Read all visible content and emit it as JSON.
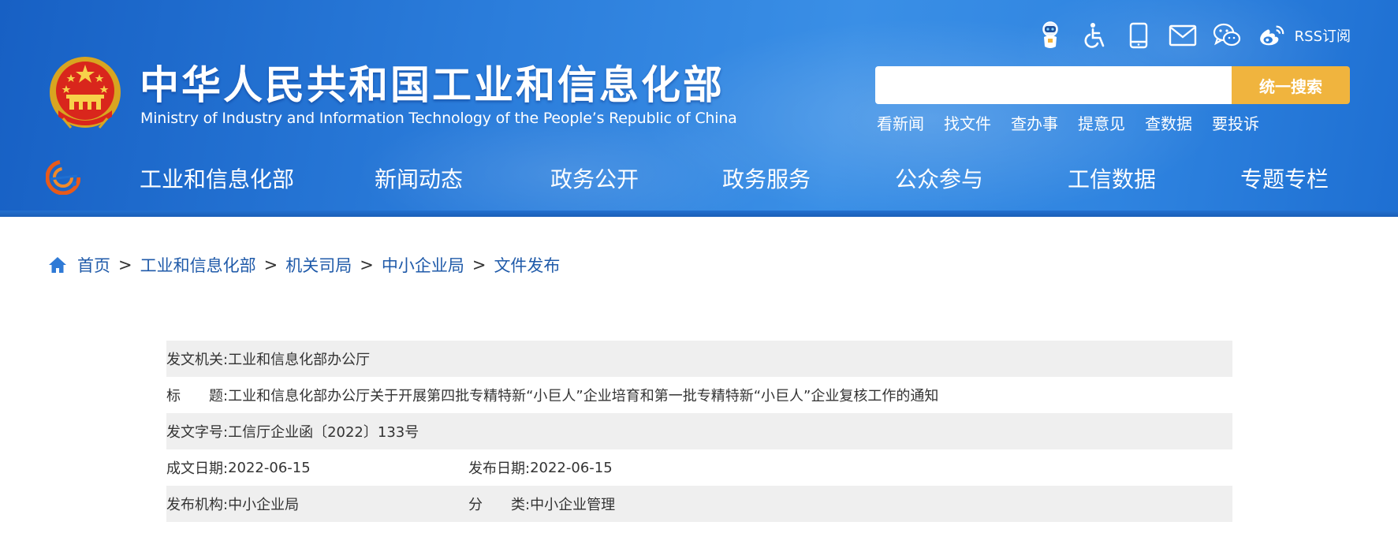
{
  "header": {
    "title_cn": "中华人民共和国工业和信息化部",
    "title_en": "Ministry of Industry and Information Technology of the People’s Republic of China",
    "tools": [
      "robot-assistant-icon",
      "accessibility-icon",
      "mobile-icon",
      "mail-icon",
      "wechat-icon",
      "weibo-icon"
    ],
    "rss_label": "RSS订阅",
    "search": {
      "placeholder": "",
      "button_label": "统一搜索"
    },
    "quick_links": [
      "看新闻",
      "找文件",
      "查办事",
      "提意见",
      "查数据",
      "要投诉"
    ],
    "nav": [
      "工业和信息化部",
      "新闻动态",
      "政务公开",
      "政务服务",
      "公众参与",
      "工信数据",
      "专题专栏"
    ]
  },
  "breadcrumb": [
    "首页",
    "工业和信息化部",
    "机关司局",
    "中小企业局",
    "文件发布"
  ],
  "meta": {
    "issuer_label": "发文机关:",
    "issuer": "工业和信息化部办公厅",
    "title_label": "标　　题:",
    "title": "工业和信息化部办公厅关于开展第四批专精特新“小巨人”企业培育和第一批专精特新“小巨人”企业复核工作的通知",
    "doc_no_label": "发文字号:",
    "doc_no": "工信厅企业函〔2022〕133号",
    "written_date_label": "成文日期:",
    "written_date": "2022-06-15",
    "publish_date_label": "发布日期:",
    "publish_date": "2022-06-15",
    "publisher_label": "发布机构:",
    "publisher": "中小企业局",
    "category_label": "分　　类:",
    "category": "中小企业管理"
  },
  "colors": {
    "header_blue": "#2b7ddb",
    "search_button": "#f0b43e",
    "breadcrumb_link": "#1f5aa9",
    "row_gray": "#efefef"
  }
}
